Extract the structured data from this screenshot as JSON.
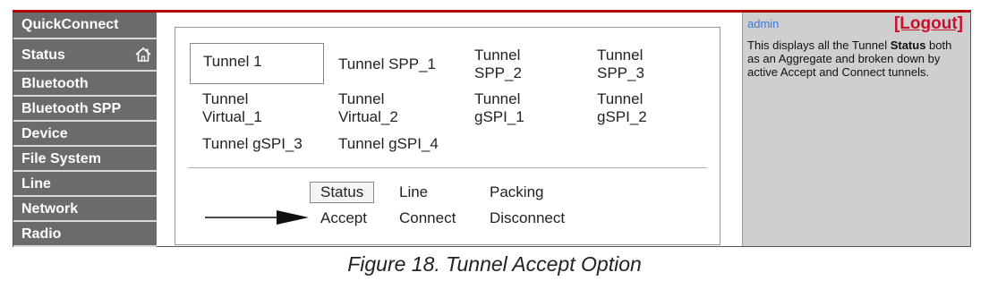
{
  "sidebar": {
    "items": [
      {
        "label": "QuickConnect"
      },
      {
        "label": "Status"
      },
      {
        "label": "Bluetooth"
      },
      {
        "label": "Bluetooth SPP"
      },
      {
        "label": "Device"
      },
      {
        "label": "File System"
      },
      {
        "label": "Line"
      },
      {
        "label": "Network"
      },
      {
        "label": "Radio"
      }
    ],
    "home_icon": "home-icon"
  },
  "tunnels": [
    {
      "label": "Tunnel 1"
    },
    {
      "label": "Tunnel SPP_1"
    },
    {
      "label": "Tunnel\nSPP_2"
    },
    {
      "label": "Tunnel\nSPP_3"
    },
    {
      "label": "Tunnel\nVirtual_1"
    },
    {
      "label": "Tunnel\nVirtual_2"
    },
    {
      "label": "Tunnel\ngSPI_1"
    },
    {
      "label": "Tunnel\ngSPI_2"
    },
    {
      "label": "Tunnel gSPI_3"
    },
    {
      "label": "Tunnel gSPI_4"
    }
  ],
  "tabs": [
    {
      "label": "Status"
    },
    {
      "label": "Line"
    },
    {
      "label": "Packing"
    },
    {
      "label": "Accept"
    },
    {
      "label": "Connect"
    },
    {
      "label": "Disconnect"
    }
  ],
  "help": {
    "user": "admin",
    "logout": "[Logout]",
    "text_before": "This displays all the Tunnel ",
    "text_bold": "Status",
    "text_after": " both as an Aggregate and broken down by active Accept and Connect tunnels."
  },
  "caption": "Figure 18.  Tunnel Accept Option"
}
